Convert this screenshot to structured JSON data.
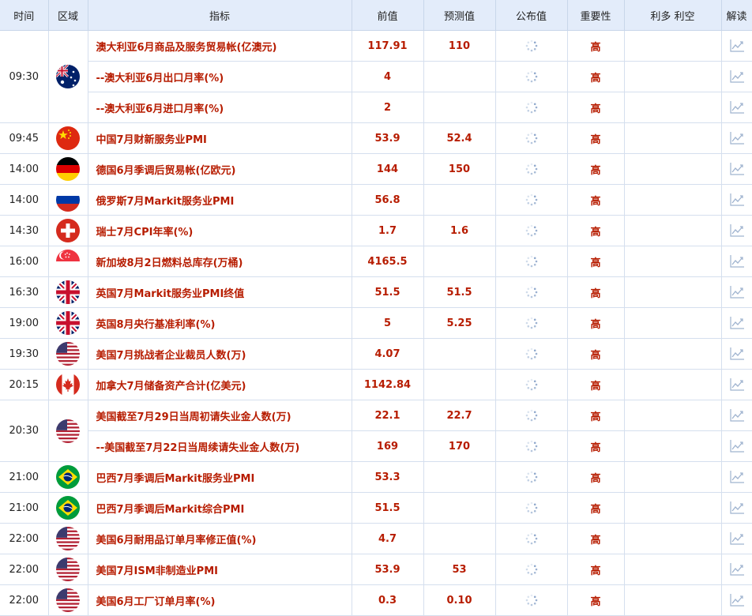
{
  "header": {
    "time": "时间",
    "region": "区域",
    "indicator": "指标",
    "previous": "前值",
    "forecast": "预测值",
    "actual": "公布值",
    "importance": "重要性",
    "impact": "利多 利空",
    "analysis": "解读"
  },
  "groups": [
    {
      "time": "09:30",
      "flag": "australia",
      "rows": [
        {
          "indicator": "澳大利亚6月商品及服务贸易帐(亿澳元)",
          "previous": "117.91",
          "forecast": "110",
          "importance": "高"
        },
        {
          "indicator": "--澳大利亚6月出口月率(%)",
          "previous": "4",
          "forecast": "",
          "importance": "高"
        },
        {
          "indicator": "--澳大利亚6月进口月率(%)",
          "previous": "2",
          "forecast": "",
          "importance": "高"
        }
      ]
    },
    {
      "time": "09:45",
      "flag": "china",
      "rows": [
        {
          "indicator": "中国7月财新服务业PMI",
          "previous": "53.9",
          "forecast": "52.4",
          "importance": "高"
        }
      ]
    },
    {
      "time": "14:00",
      "flag": "germany",
      "rows": [
        {
          "indicator": "德国6月季调后贸易帐(亿欧元)",
          "previous": "144",
          "forecast": "150",
          "importance": "高"
        }
      ]
    },
    {
      "time": "14:00",
      "flag": "russia",
      "rows": [
        {
          "indicator": "俄罗斯7月Markit服务业PMI",
          "previous": "56.8",
          "forecast": "",
          "importance": "高"
        }
      ]
    },
    {
      "time": "14:30",
      "flag": "switzerland",
      "rows": [
        {
          "indicator": "瑞士7月CPI年率(%)",
          "previous": "1.7",
          "forecast": "1.6",
          "importance": "高"
        }
      ]
    },
    {
      "time": "16:00",
      "flag": "singapore",
      "rows": [
        {
          "indicator": "新加坡8月2日燃料总库存(万桶)",
          "previous": "4165.5",
          "forecast": "",
          "importance": "高"
        }
      ]
    },
    {
      "time": "16:30",
      "flag": "uk",
      "rows": [
        {
          "indicator": "英国7月Markit服务业PMI终值",
          "previous": "51.5",
          "forecast": "51.5",
          "importance": "高"
        }
      ]
    },
    {
      "time": "19:00",
      "flag": "uk",
      "rows": [
        {
          "indicator": "英国8月央行基准利率(%)",
          "previous": "5",
          "forecast": "5.25",
          "importance": "高"
        }
      ]
    },
    {
      "time": "19:30",
      "flag": "usa",
      "rows": [
        {
          "indicator": "美国7月挑战者企业裁员人数(万)",
          "previous": "4.07",
          "forecast": "",
          "importance": "高"
        }
      ]
    },
    {
      "time": "20:15",
      "flag": "canada",
      "rows": [
        {
          "indicator": "加拿大7月储备资产合计(亿美元)",
          "previous": "1142.84",
          "forecast": "",
          "importance": "高"
        }
      ]
    },
    {
      "time": "20:30",
      "flag": "usa",
      "rows": [
        {
          "indicator": "美国截至7月29日当周初请失业金人数(万)",
          "previous": "22.1",
          "forecast": "22.7",
          "importance": "高"
        },
        {
          "indicator": "--美国截至7月22日当周续请失业金人数(万)",
          "previous": "169",
          "forecast": "170",
          "importance": "高"
        }
      ]
    },
    {
      "time": "21:00",
      "flag": "brazil",
      "rows": [
        {
          "indicator": "巴西7月季调后Markit服务业PMI",
          "previous": "53.3",
          "forecast": "",
          "importance": "高"
        }
      ]
    },
    {
      "time": "21:00",
      "flag": "brazil",
      "rows": [
        {
          "indicator": "巴西7月季调后Markit综合PMI",
          "previous": "51.5",
          "forecast": "",
          "importance": "高"
        }
      ]
    },
    {
      "time": "22:00",
      "flag": "usa",
      "rows": [
        {
          "indicator": "美国6月耐用品订单月率修正值(%)",
          "previous": "4.7",
          "forecast": "",
          "importance": "高"
        }
      ]
    },
    {
      "time": "22:00",
      "flag": "usa",
      "rows": [
        {
          "indicator": "美国7月ISM非制造业PMI",
          "previous": "53.9",
          "forecast": "53",
          "importance": "高"
        }
      ]
    },
    {
      "time": "22:00",
      "flag": "usa",
      "rows": [
        {
          "indicator": "美国6月工厂订单月率(%)",
          "previous": "0.3",
          "forecast": "0.10",
          "importance": "高"
        }
      ]
    }
  ],
  "colors": {
    "accent_red": "#b71c00",
    "header_bg": "#e3ecfa",
    "grid": "#d5dfee"
  },
  "icons": {
    "actual": "loading-spinner-icon",
    "analysis": "line-chart-icon"
  }
}
